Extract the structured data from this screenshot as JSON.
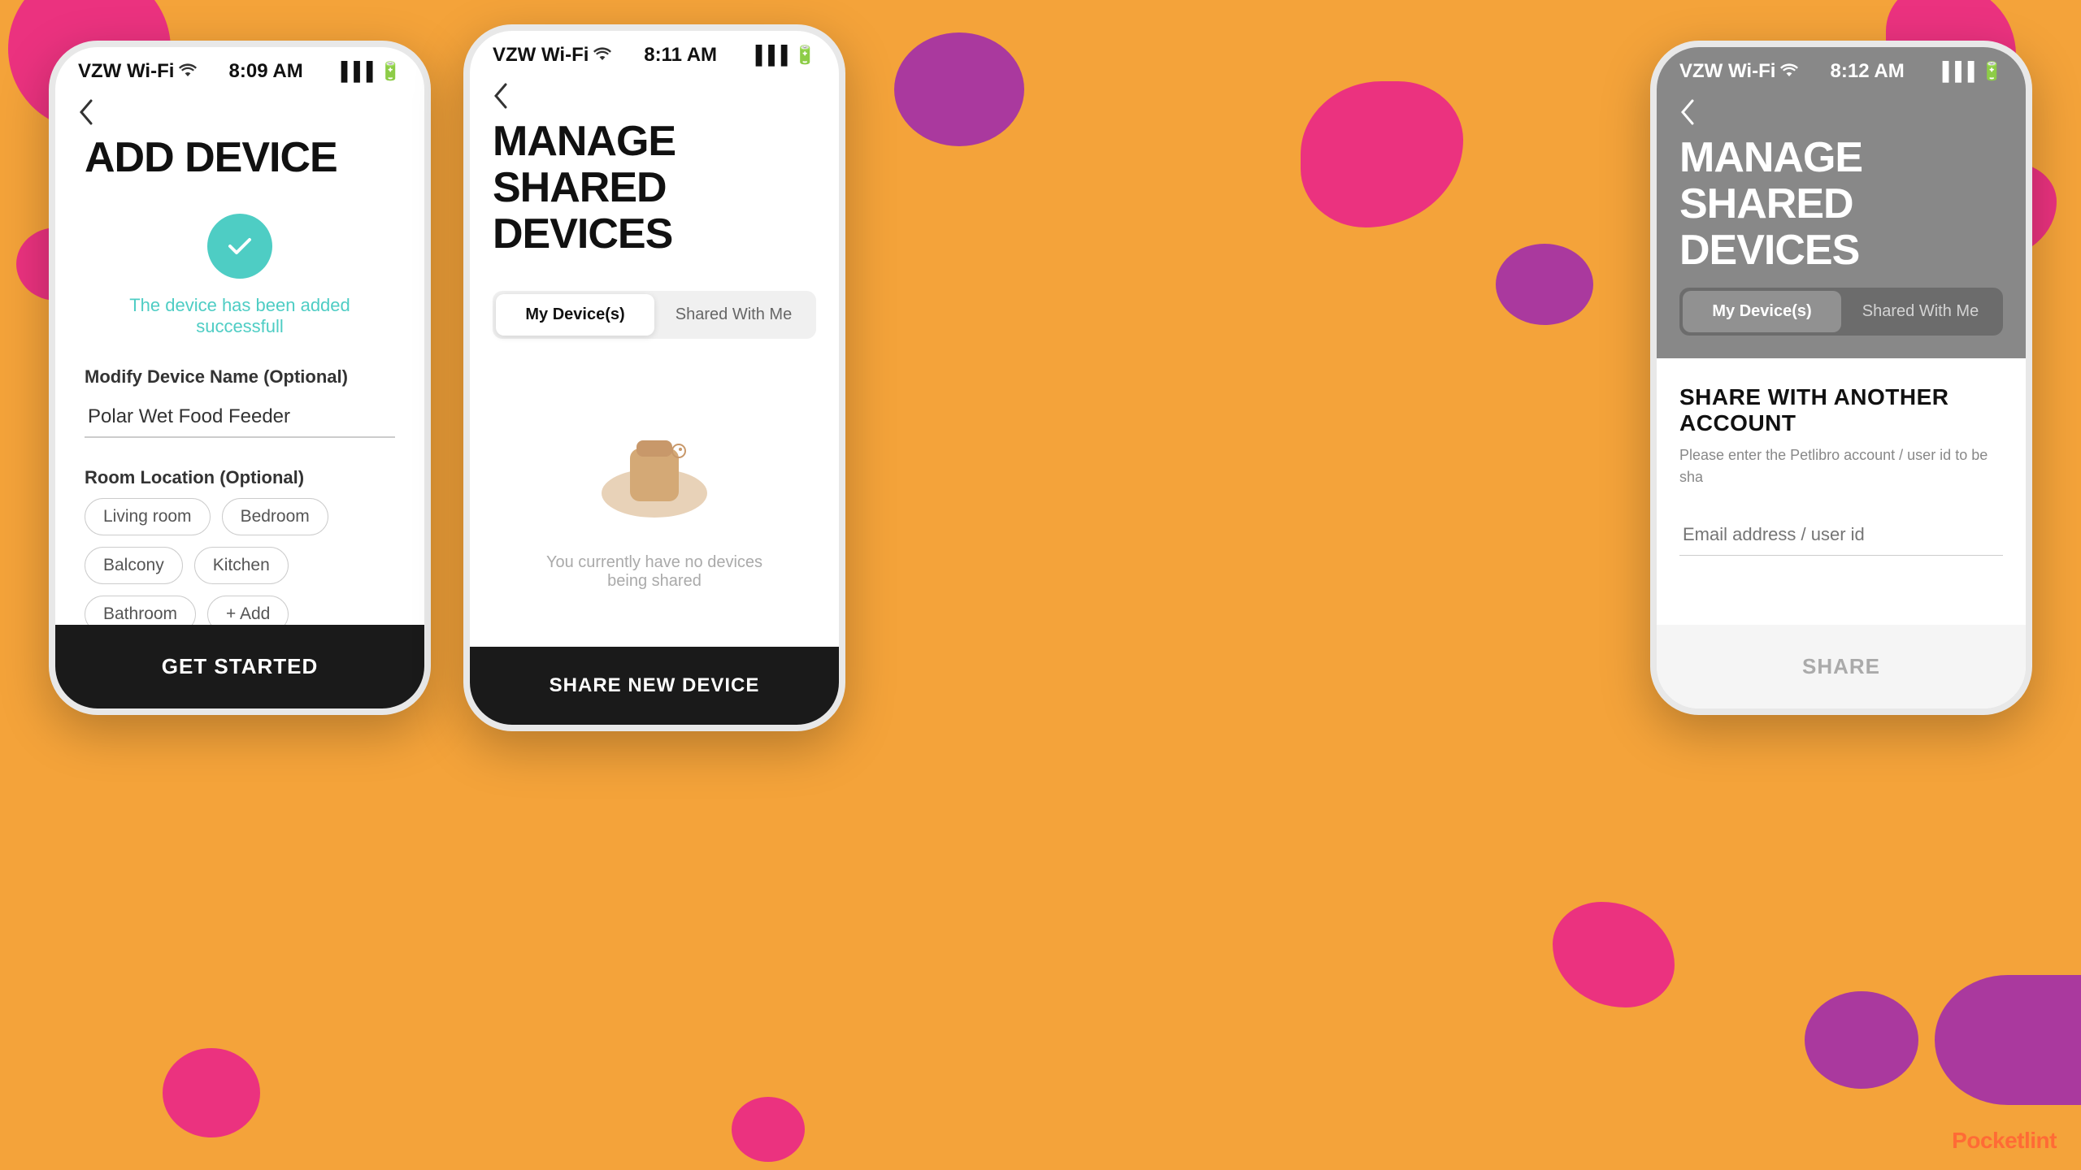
{
  "background": {
    "color": "#F4A33A"
  },
  "phone1": {
    "status_bar": {
      "carrier": "VZW Wi-Fi",
      "time": "8:09 AM"
    },
    "title": "ADD DEVICE",
    "success_message": "The device has been added successfull",
    "device_name_label": "Modify Device Name (Optional)",
    "device_name_value": "Polar Wet Food Feeder",
    "room_label": "Room Location (Optional)",
    "rooms": [
      "Living room",
      "Bedroom",
      "Balcony",
      "Kitchen",
      "Bathroom"
    ],
    "add_label": "+ Add",
    "cta": "GET STARTED"
  },
  "phone2": {
    "status_bar": {
      "carrier": "VZW Wi-Fi",
      "time": "8:11 AM"
    },
    "title": "MANAGE SHARED\nDEVICES",
    "tab_my_devices": "My Device(s)",
    "tab_shared_with_me": "Shared With Me",
    "empty_state_text": "You currently have no devices being shared",
    "cta": "SHARE NEW DEVICE"
  },
  "phone3": {
    "status_bar": {
      "carrier": "VZW Wi-Fi",
      "time": "8:12 AM"
    },
    "title": "MANAGE SHARED\nDEVICES",
    "tab_my_devices": "My Device(s)",
    "tab_shared_with_me": "Shared With Me",
    "share_section_title": "SHARE WITH ANOTHER ACCOUNT",
    "share_subtitle": "Please enter the Petlibro account / user id to be sha",
    "email_placeholder": "Email address / user id",
    "cta": "SHARE"
  },
  "watermark": "Pocketlint"
}
